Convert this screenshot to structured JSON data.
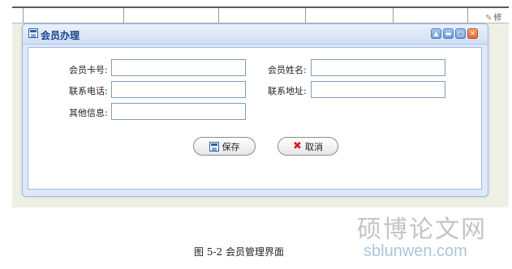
{
  "background": {
    "edit_label": "修"
  },
  "window": {
    "title": "会员办理",
    "title_buttons": [
      "collapse",
      "minimize",
      "maximize",
      "close"
    ]
  },
  "form": {
    "card_no_label": "会员卡号:",
    "card_no_value": "",
    "name_label": "会员姓名:",
    "name_value": "",
    "phone_label": "联系电话:",
    "phone_value": "",
    "address_label": "联系地址:",
    "address_value": "",
    "other_label": "其他信息:",
    "other_value": ""
  },
  "buttons": {
    "save_label": "保存",
    "cancel_label": "取消"
  },
  "caption": "图 5-2 会员管理界面",
  "watermark": {
    "cn": "硕博论文网",
    "en": "sblunwen.com"
  },
  "colors": {
    "window_border": "#99bbe8",
    "title_text": "#15428b",
    "close_button": "#e06a33",
    "cancel_icon": "#d62020"
  }
}
